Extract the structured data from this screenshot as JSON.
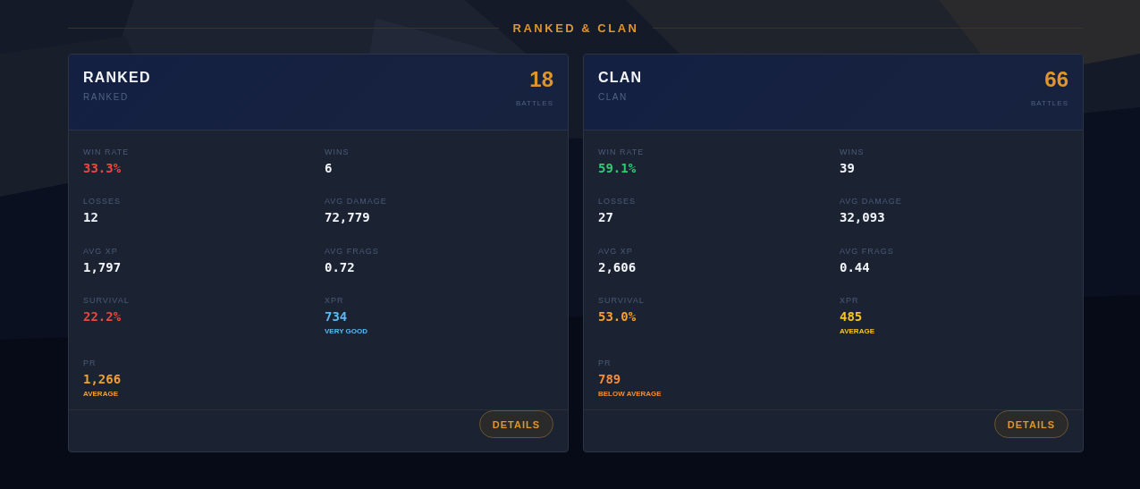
{
  "section_title": "RANKED & CLAN",
  "cards": [
    {
      "title": "RANKED",
      "subtitle": "RANKED",
      "battles": "18",
      "battles_label": "BATTLES",
      "button": "DETAILS",
      "stats": [
        {
          "label": "WIN RATE",
          "value": "33.3%",
          "color": "#e8493f"
        },
        {
          "label": "WINS",
          "value": "6",
          "color": "#f1f4f8"
        },
        {
          "label": "LOSSES",
          "value": "12",
          "color": "#f1f4f8"
        },
        {
          "label": "AVG DAMAGE",
          "value": "72,779",
          "color": "#f1f4f8"
        },
        {
          "label": "AVG XP",
          "value": "1,797",
          "color": "#f1f4f8"
        },
        {
          "label": "AVG FRAGS",
          "value": "0.72",
          "color": "#f1f4f8"
        },
        {
          "label": "SURVIVAL",
          "value": "22.2%",
          "color": "#e8493f"
        },
        {
          "label": "XPR",
          "value": "734",
          "rating": "VERY GOOD",
          "color": "#5ab8f0"
        },
        {
          "label": "PR",
          "value": "1,266",
          "rating": "AVERAGE",
          "color": "#f0a030"
        }
      ]
    },
    {
      "title": "CLAN",
      "subtitle": "CLAN",
      "battles": "66",
      "battles_label": "BATTLES",
      "button": "DETAILS",
      "stats": [
        {
          "label": "WIN RATE",
          "value": "59.1%",
          "color": "#2ecc71"
        },
        {
          "label": "WINS",
          "value": "39",
          "color": "#f1f4f8"
        },
        {
          "label": "LOSSES",
          "value": "27",
          "color": "#f1f4f8"
        },
        {
          "label": "AVG DAMAGE",
          "value": "32,093",
          "color": "#f1f4f8"
        },
        {
          "label": "AVG XP",
          "value": "2,606",
          "color": "#f1f4f8"
        },
        {
          "label": "AVG FRAGS",
          "value": "0.44",
          "color": "#f1f4f8"
        },
        {
          "label": "SURVIVAL",
          "value": "53.0%",
          "color": "#f0a030"
        },
        {
          "label": "XPR",
          "value": "485",
          "rating": "AVERAGE",
          "color": "#f5c518"
        },
        {
          "label": "PR",
          "value": "789",
          "rating": "BELOW AVERAGE",
          "color": "#f28c38"
        }
      ]
    }
  ]
}
